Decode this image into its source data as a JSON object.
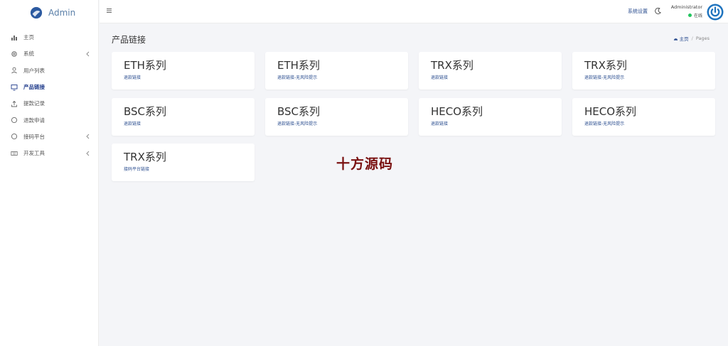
{
  "brand": {
    "name": "Admin"
  },
  "sidebar": {
    "items": [
      {
        "label": "主页",
        "icon": "bar-chart-icon",
        "active": false
      },
      {
        "label": "系统",
        "icon": "gear-icon",
        "active": false,
        "has_children": true
      },
      {
        "label": "用户列表",
        "icon": "user-icon",
        "active": false
      },
      {
        "label": "产品链接",
        "icon": "monitor-icon",
        "active": true
      },
      {
        "label": "提款记录",
        "icon": "upload-icon",
        "active": false
      },
      {
        "label": "退款申请",
        "icon": "circle-icon",
        "active": false
      },
      {
        "label": "接码平台",
        "icon": "circle-icon",
        "active": false,
        "has_children": true
      },
      {
        "label": "开发工具",
        "icon": "keyboard-icon",
        "active": false,
        "has_children": true
      }
    ]
  },
  "topbar": {
    "menu_icon": "hamburger-icon",
    "settings_label": "系统设置",
    "theme_icon": "moon-icon",
    "user_name": "Administrator",
    "user_status": "在线",
    "status_color": "#22c55e",
    "avatar_icon": "power-icon",
    "avatar_color": "#1e73be"
  },
  "page": {
    "title": "产品链接",
    "breadcrumb": {
      "home": "主页",
      "separator": "/",
      "current": "Pages"
    }
  },
  "cards": [
    {
      "title": "ETH系列",
      "subtitle": "退款链接"
    },
    {
      "title": "ETH系列",
      "subtitle": "退款链接-无风险提示"
    },
    {
      "title": "TRX系列",
      "subtitle": "退款链接"
    },
    {
      "title": "TRX系列",
      "subtitle": "退款链接-无风险提示"
    },
    {
      "title": "BSC系列",
      "subtitle": "退款链接"
    },
    {
      "title": "BSC系列",
      "subtitle": "退款链接-无风险提示"
    },
    {
      "title": "HECO系列",
      "subtitle": "退款链接"
    },
    {
      "title": "HECO系列",
      "subtitle": "退款链接-无风险提示"
    },
    {
      "title": "TRX系列",
      "subtitle": "接码平台链接"
    }
  ],
  "watermark": "十方源码",
  "colors": {
    "accent": "#1e3a8a",
    "link": "#2a4d8f",
    "watermark": "#7a1111",
    "background": "#f4f5f8"
  }
}
